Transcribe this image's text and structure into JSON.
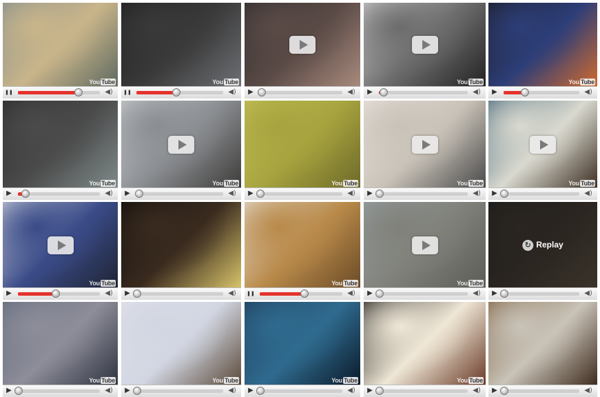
{
  "logo_text": {
    "you": "You",
    "tube": "Tube"
  },
  "icons": {
    "play": "play-icon",
    "pause": "pause-icon",
    "volume": "volume-icon",
    "big_play": "big-play-icon",
    "replay": "replay-icon"
  },
  "colors": {
    "progress": "#e5322d",
    "controls_bg": "#e6e6e6"
  },
  "rows": [
    {
      "videos": [
        {
          "state": "paused",
          "progress": 0.73,
          "bg": [
            "#7c8a8f",
            "#c9b58a",
            "#5f6a60"
          ],
          "overlay": "none",
          "logo": true
        },
        {
          "state": "paused",
          "progress": 0.45,
          "bg": [
            "#1d1d1d",
            "#3a3a3a",
            "#6d6f73"
          ],
          "overlay": "none",
          "logo": true
        },
        {
          "state": "playing",
          "progress": 0.02,
          "bg": [
            "#2b2b2b",
            "#5b4b47",
            "#a88a7d"
          ],
          "overlay": "play",
          "logo": false
        },
        {
          "state": "playing",
          "progress": 0.05,
          "bg": [
            "#d6d6d6",
            "#6c6c6c",
            "#232323"
          ],
          "overlay": "play",
          "logo": true
        },
        {
          "state": "playing",
          "progress": 0.27,
          "bg": [
            "#1a1a1a",
            "#2d3e78",
            "#d06a2e"
          ],
          "overlay": "none",
          "logo": true
        }
      ]
    },
    {
      "videos": [
        {
          "state": "playing",
          "progress": 0.08,
          "bg": [
            "#2a2a2a",
            "#4b4b4b",
            "#7f8a8a"
          ],
          "overlay": "none",
          "logo": true
        },
        {
          "state": "playing",
          "progress": 0.02,
          "bg": [
            "#cfd3d6",
            "#8a8d91",
            "#3e3c3a"
          ],
          "overlay": "play",
          "logo": true
        },
        {
          "state": "playing",
          "progress": 0.0,
          "bg": [
            "#c7c35a",
            "#a7a33e",
            "#6e6a2a"
          ],
          "overlay": "none",
          "logo": true
        },
        {
          "state": "playing",
          "progress": 0.0,
          "bg": [
            "#ece7e2",
            "#c9c2b8",
            "#4a4a4a"
          ],
          "overlay": "play",
          "logo": true
        },
        {
          "state": "playing",
          "progress": 0.0,
          "bg": [
            "#3b5f75",
            "#d9d9cf",
            "#3d2e22"
          ],
          "overlay": "play",
          "logo": true
        }
      ]
    },
    {
      "videos": [
        {
          "state": "playing",
          "progress": 0.45,
          "bg": [
            "#dadde2",
            "#3a4b88",
            "#1f2433"
          ],
          "overlay": "play",
          "logo": true
        },
        {
          "state": "playing",
          "progress": 0.0,
          "bg": [
            "#0b0b0b",
            "#3a2b1f",
            "#d8c36a"
          ],
          "overlay": "none",
          "logo": false
        },
        {
          "state": "paused",
          "progress": 0.53,
          "bg": [
            "#e9e6e0",
            "#b98a4a",
            "#6b4b26"
          ],
          "overlay": "none",
          "logo": true
        },
        {
          "state": "playing",
          "progress": 0.0,
          "bg": [
            "#9aa2a6",
            "#80817a",
            "#5c5c58"
          ],
          "overlay": "play",
          "logo": true
        },
        {
          "state": "playing",
          "progress": 0.0,
          "bg": [
            "#1b1b1b",
            "#2a2520",
            "#3a332b"
          ],
          "overlay": "replay",
          "replay_label": "Replay",
          "logo": false
        }
      ]
    },
    {
      "videos": [
        {
          "state": "playing",
          "progress": 0.0,
          "bg": [
            "#5b6878",
            "#8e8d9a",
            "#2f3440"
          ],
          "overlay": "none",
          "logo": true
        },
        {
          "state": "playing",
          "progress": 0.0,
          "bg": [
            "#e0e2ea",
            "#d2d6e2",
            "#5a4a3a"
          ],
          "overlay": "none",
          "logo": true
        },
        {
          "state": "playing",
          "progress": 0.0,
          "bg": [
            "#1f3a55",
            "#2f6b8f",
            "#0c1a2a"
          ],
          "overlay": "none",
          "logo": true
        },
        {
          "state": "playing",
          "progress": 0.0,
          "bg": [
            "#0d0d0d",
            "#efe7d6",
            "#6a3a28"
          ],
          "overlay": "none",
          "logo": true
        },
        {
          "state": "playing",
          "progress": 0.0,
          "bg": [
            "#7a5b3a",
            "#c9c3b8",
            "#3e2c1e"
          ],
          "overlay": "none",
          "logo": false
        }
      ]
    }
  ]
}
